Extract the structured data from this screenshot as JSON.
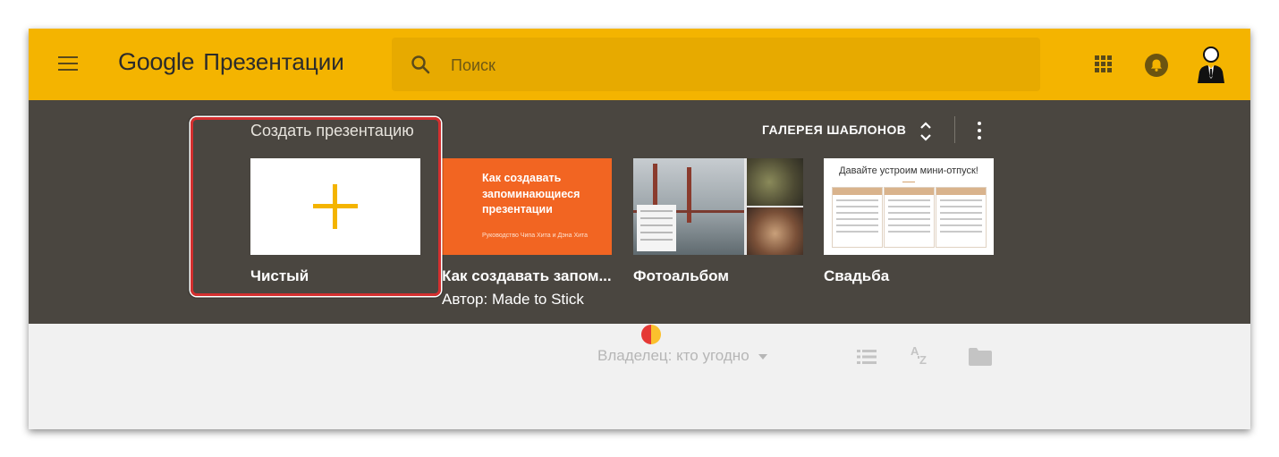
{
  "header": {
    "menu_icon": "hamburger-menu-icon",
    "logo_google": "Google",
    "app_name": "Презентации",
    "search_placeholder": "Поиск",
    "accent_color": "#f4b400"
  },
  "gallery": {
    "title": "Создать презентацию",
    "gallery_link": "ГАЛЕРЕЯ ШАБЛОНОВ",
    "background_color": "#4a4640",
    "templates": [
      {
        "name": "Чистый",
        "subtitle": ""
      },
      {
        "name": "Как создавать запом...",
        "subtitle": "Автор: Made to Stick",
        "thumb_title": "Как создавать запоминающиеся презентации",
        "thumb_credit": "Руководство Чипа Хита и Дэна Хита"
      },
      {
        "name": "Фотоальбом",
        "subtitle": ""
      },
      {
        "name": "Свадьба",
        "subtitle": "",
        "thumb_title": "Давайте устроим мини-отпуск!"
      }
    ]
  },
  "toolbar": {
    "owner_filter": "Владелец: кто угодно",
    "icons": [
      "list-view-icon",
      "sort-az-icon",
      "folder-icon"
    ]
  }
}
